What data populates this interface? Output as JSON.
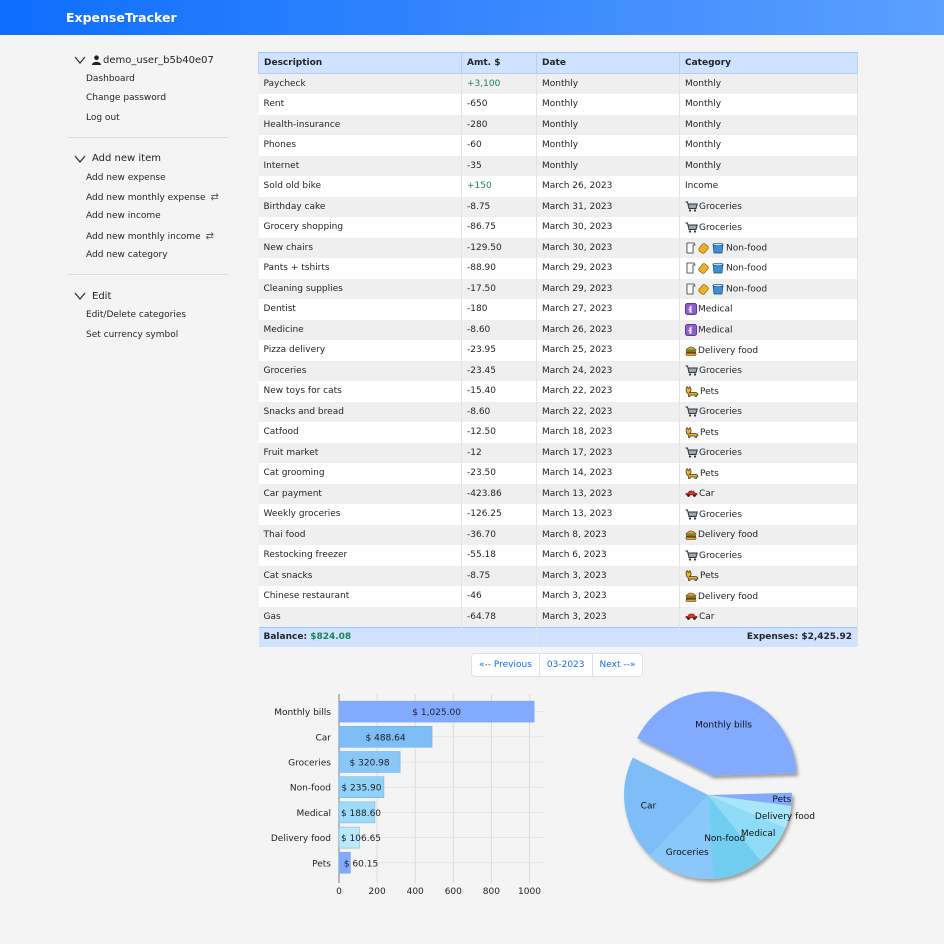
{
  "app": {
    "title": "ExpenseTracker"
  },
  "sidebar": {
    "user": {
      "name": "demo_user_b5b40e07",
      "links": [
        "Dashboard",
        "Change password",
        "Log out"
      ]
    },
    "add": {
      "title": "Add new item",
      "links": [
        {
          "label": "Add new expense",
          "repeat": false
        },
        {
          "label": "Add new monthly expense",
          "repeat": true
        },
        {
          "label": "Add new income",
          "repeat": false
        },
        {
          "label": "Add new monthly income",
          "repeat": true
        },
        {
          "label": "Add new category",
          "repeat": false
        }
      ]
    },
    "edit": {
      "title": "Edit",
      "links": [
        "Edit/Delete categories",
        "Set currency symbol"
      ]
    }
  },
  "table": {
    "headers": [
      "Description",
      "Amt. $",
      "Date",
      "Category"
    ],
    "rows": [
      {
        "desc": "Paycheck",
        "amt": "+3,100",
        "date": "Monthly",
        "cat": "Monthly",
        "icon": ""
      },
      {
        "desc": "Rent",
        "amt": "-650",
        "date": "Monthly",
        "cat": "Monthly",
        "icon": ""
      },
      {
        "desc": "Health-insurance",
        "amt": "-280",
        "date": "Monthly",
        "cat": "Monthly",
        "icon": ""
      },
      {
        "desc": "Phones",
        "amt": "-60",
        "date": "Monthly",
        "cat": "Monthly",
        "icon": ""
      },
      {
        "desc": "Internet",
        "amt": "-35",
        "date": "Monthly",
        "cat": "Monthly",
        "icon": ""
      },
      {
        "desc": "Sold old bike",
        "amt": "+150",
        "date": "March 26, 2023",
        "cat": "Income",
        "icon": ""
      },
      {
        "desc": "Birthday cake",
        "amt": "-8.75",
        "date": "March 31, 2023",
        "cat": "Groceries",
        "icon": "cart"
      },
      {
        "desc": "Grocery shopping",
        "amt": "-86.75",
        "date": "March 30, 2023",
        "cat": "Groceries",
        "icon": "cart"
      },
      {
        "desc": "New chairs",
        "amt": "-129.50",
        "date": "March 30, 2023",
        "cat": "Non-food",
        "icon": "nonfood"
      },
      {
        "desc": "Pants + tshirts",
        "amt": "-88.90",
        "date": "March 29, 2023",
        "cat": "Non-food",
        "icon": "nonfood"
      },
      {
        "desc": "Cleaning supplies",
        "amt": "-17.50",
        "date": "March 29, 2023",
        "cat": "Non-food",
        "icon": "nonfood"
      },
      {
        "desc": "Dentist",
        "amt": "-180",
        "date": "March 27, 2023",
        "cat": "Medical",
        "icon": "medical"
      },
      {
        "desc": "Medicine",
        "amt": "-8.60",
        "date": "March 26, 2023",
        "cat": "Medical",
        "icon": "medical"
      },
      {
        "desc": "Pizza delivery",
        "amt": "-23.95",
        "date": "March 25, 2023",
        "cat": "Delivery food",
        "icon": "burger"
      },
      {
        "desc": "Groceries",
        "amt": "-23.45",
        "date": "March 24, 2023",
        "cat": "Groceries",
        "icon": "cart"
      },
      {
        "desc": "New toys for cats",
        "amt": "-15.40",
        "date": "March 22, 2023",
        "cat": "Pets",
        "icon": "cat"
      },
      {
        "desc": "Snacks and bread",
        "amt": "-8.60",
        "date": "March 22, 2023",
        "cat": "Groceries",
        "icon": "cart"
      },
      {
        "desc": "Catfood",
        "amt": "-12.50",
        "date": "March 18, 2023",
        "cat": "Pets",
        "icon": "cat"
      },
      {
        "desc": "Fruit market",
        "amt": "-12",
        "date": "March 17, 2023",
        "cat": "Groceries",
        "icon": "cart"
      },
      {
        "desc": "Cat grooming",
        "amt": "-23.50",
        "date": "March 14, 2023",
        "cat": "Pets",
        "icon": "cat"
      },
      {
        "desc": "Car payment",
        "amt": "-423.86",
        "date": "March 13, 2023",
        "cat": "Car",
        "icon": "car"
      },
      {
        "desc": "Weekly groceries",
        "amt": "-126.25",
        "date": "March 13, 2023",
        "cat": "Groceries",
        "icon": "cart"
      },
      {
        "desc": "Thai food",
        "amt": "-36.70",
        "date": "March 8, 2023",
        "cat": "Delivery food",
        "icon": "burger"
      },
      {
        "desc": "Restocking freezer",
        "amt": "-55.18",
        "date": "March 6, 2023",
        "cat": "Groceries",
        "icon": "cart"
      },
      {
        "desc": "Cat snacks",
        "amt": "-8.75",
        "date": "March 3, 2023",
        "cat": "Pets",
        "icon": "cat"
      },
      {
        "desc": "Chinese restaurant",
        "amt": "-46",
        "date": "March 3, 2023",
        "cat": "Delivery food",
        "icon": "burger"
      },
      {
        "desc": "Gas",
        "amt": "-64.78",
        "date": "March 3, 2023",
        "cat": "Car",
        "icon": "car"
      }
    ],
    "balance_label": "Balance:",
    "balance_value": "$824.08",
    "expenses_label": "Expenses: $2,425.92"
  },
  "pagination": {
    "prev": "«-- Previous",
    "current": "03-2023",
    "next": "Next --»"
  },
  "colors": {
    "accent": "#0d6efd",
    "positive": "#198754",
    "header_bg": "#cfe2ff"
  },
  "chart_data": [
    {
      "type": "bar",
      "orientation": "horizontal",
      "categories": [
        "Monthly bills",
        "Car",
        "Groceries",
        "Non-food",
        "Medical",
        "Delivery food",
        "Pets"
      ],
      "values": [
        1025.0,
        488.64,
        320.98,
        235.9,
        188.6,
        106.65,
        60.15
      ],
      "labels": [
        "$ 1,025.00",
        "$ 488.64",
        "$ 320.98",
        "$ 235.90",
        "$ 188.60",
        "$ 106.65",
        "$ 60.15"
      ],
      "xticks": [
        0,
        200,
        400,
        600,
        800,
        1000
      ],
      "xlim": [
        0,
        1080
      ],
      "grid": true,
      "colors": [
        "#82aaff",
        "#7dbdf8",
        "#89c7f9",
        "#8fd3f8",
        "#9cdcfa",
        "#b7eafd",
        "#82aaff"
      ]
    },
    {
      "type": "pie",
      "categories": [
        "Monthly bills",
        "Car",
        "Groceries",
        "Non-food",
        "Medical",
        "Delivery food",
        "Pets"
      ],
      "values": [
        1025.0,
        488.64,
        320.98,
        235.9,
        188.6,
        106.65,
        60.15
      ],
      "exploded": "Monthly bills",
      "colors": [
        "#82aaff",
        "#7ebdf7",
        "#8ac7fa",
        "#72cef0",
        "#8fdcf8",
        "#a8e6fc",
        "#82aaff"
      ]
    }
  ]
}
